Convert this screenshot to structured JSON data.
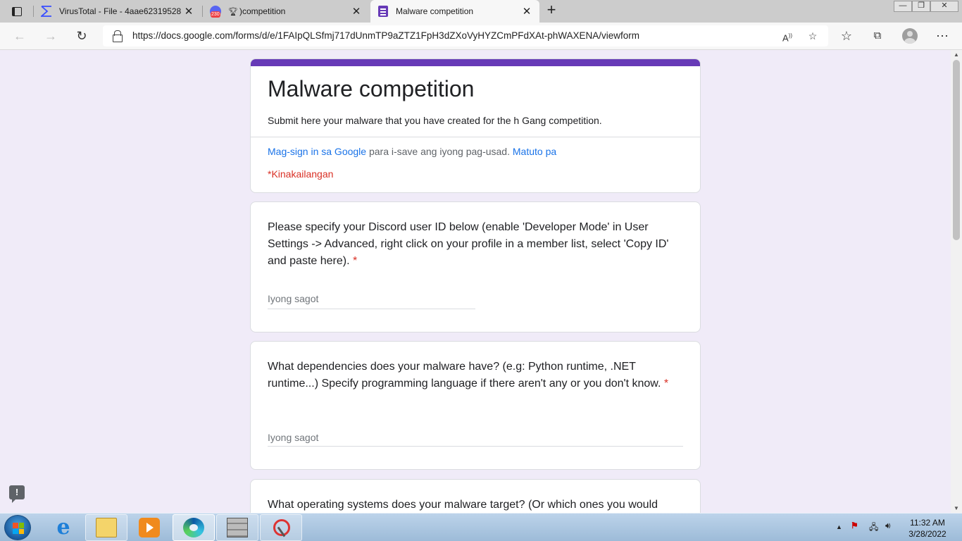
{
  "browser": {
    "tabs": [
      {
        "title": "VirusTotal - File - 4aae62319528",
        "active": false,
        "close": "✕"
      },
      {
        "title": ")competition",
        "active": false,
        "close": "✕",
        "badge": "230"
      },
      {
        "title": "Malware competition",
        "active": true,
        "close": "✕"
      }
    ],
    "new_tab": "+",
    "url": "https://docs.google.com/forms/d/e/1FAIpQLSfmj717dUnmTP9aZTZ1FpH3dZXoVyHYZCmPFdXAt-phWAXENA/viewform",
    "icons": {
      "back": "back-arrow-icon",
      "forward": "forward-arrow-icon",
      "refresh": "refresh-icon",
      "lock": "lock-icon",
      "read_aloud": "read-aloud-icon",
      "add_favorite": "add-favorite-icon",
      "favorites": "favorites-icon",
      "collections": "collections-icon",
      "profile": "profile-avatar-icon",
      "more": "more-icon"
    }
  },
  "form": {
    "accent_color": "#673ab7",
    "background_color": "#f0ebf8",
    "title": "Malware competition",
    "description": "Submit here your malware that you have created for the h Gang competition.",
    "signin_link": "Mag-sign in sa Google",
    "signin_text": " para i-save ang iyong pag-usad. ",
    "learn_more": "Matuto pa",
    "required_note": "*Kinakailangan",
    "questions": [
      {
        "text": "Please specify your Discord user ID below (enable 'Developer Mode' in User Settings -> Advanced, right click on your profile in a member list, select 'Copy ID' and paste here).",
        "required_mark": "*",
        "placeholder": "Iyong sagot"
      },
      {
        "text": "What dependencies does your malware have? (e.g: Python runtime, .NET runtime...) Specify programming language if there aren't any or you don't know.",
        "required_mark": "*",
        "placeholder": "Iyong sagot"
      },
      {
        "text": "What operating systems does your malware target? (Or which ones you would"
      }
    ],
    "feedback_icon": "!"
  },
  "taskbar": {
    "apps": [
      "internet-explorer",
      "file-explorer",
      "media-player",
      "edge",
      "firewall",
      "snipping-tool"
    ],
    "clock_time": "11:32 AM",
    "clock_date": "3/28/2022",
    "tray_icons": [
      "show-hidden-icons",
      "action-center-flag-icon",
      "network-icon",
      "volume-icon"
    ]
  }
}
